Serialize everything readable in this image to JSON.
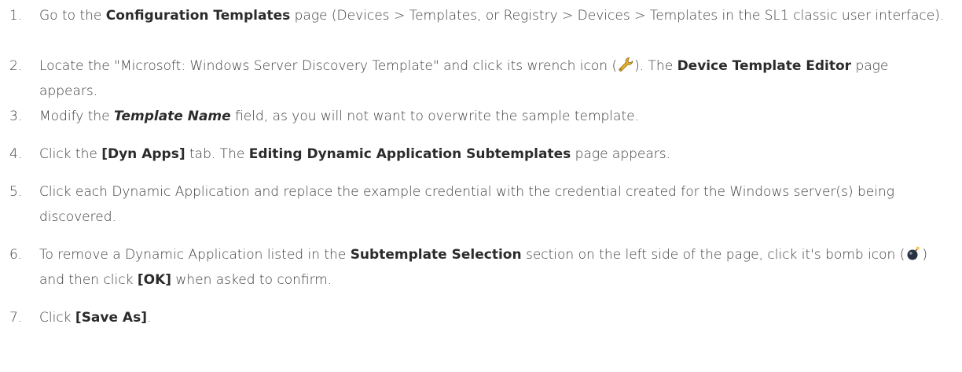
{
  "steps": [
    {
      "number": "1.",
      "p1": "Go to the ",
      "b1": "Configuration Templates",
      "p2": " page (Devices > Templates, or Registry > Devices > Templates in the SL1 classic user interface)."
    },
    {
      "number": "2.",
      "p1": "Locate the \"Microsoft: Windows Server Discovery Template\" and click its wrench icon (",
      "p2": "). The ",
      "b1": "Device Template Editor",
      "p3": " page appears.",
      "icon": "wrench-icon"
    },
    {
      "number": "3.",
      "p1": "Modify the ",
      "b1": "Template Name",
      "p2": " field, as you will not want to overwrite the sample template."
    },
    {
      "number": "4.",
      "p1": "Click the ",
      "b1": "[Dyn Apps]",
      "p2": " tab. The ",
      "b2": "Editing Dynamic Application Subtemplates",
      "p3": " page appears."
    },
    {
      "number": "5.",
      "p1": "Click each Dynamic Application and replace the example credential with the credential created for the Windows server(s) being discovered."
    },
    {
      "number": "6.",
      "p1": "To remove a Dynamic Application listed in the ",
      "b1": "Subtemplate Selection",
      "p2": " section on the left side of the page, click it's bomb icon (",
      "p3": ") and then click ",
      "b2": "[OK]",
      "p4": " when asked to confirm.",
      "icon": "bomb-icon"
    },
    {
      "number": "7.",
      "p1": "Click ",
      "b1": "[Save As]",
      "p2": "."
    }
  ],
  "colors": {
    "text": "#3c3c3c",
    "wrench": "#e8b32a",
    "bomb": "#2a3140"
  }
}
